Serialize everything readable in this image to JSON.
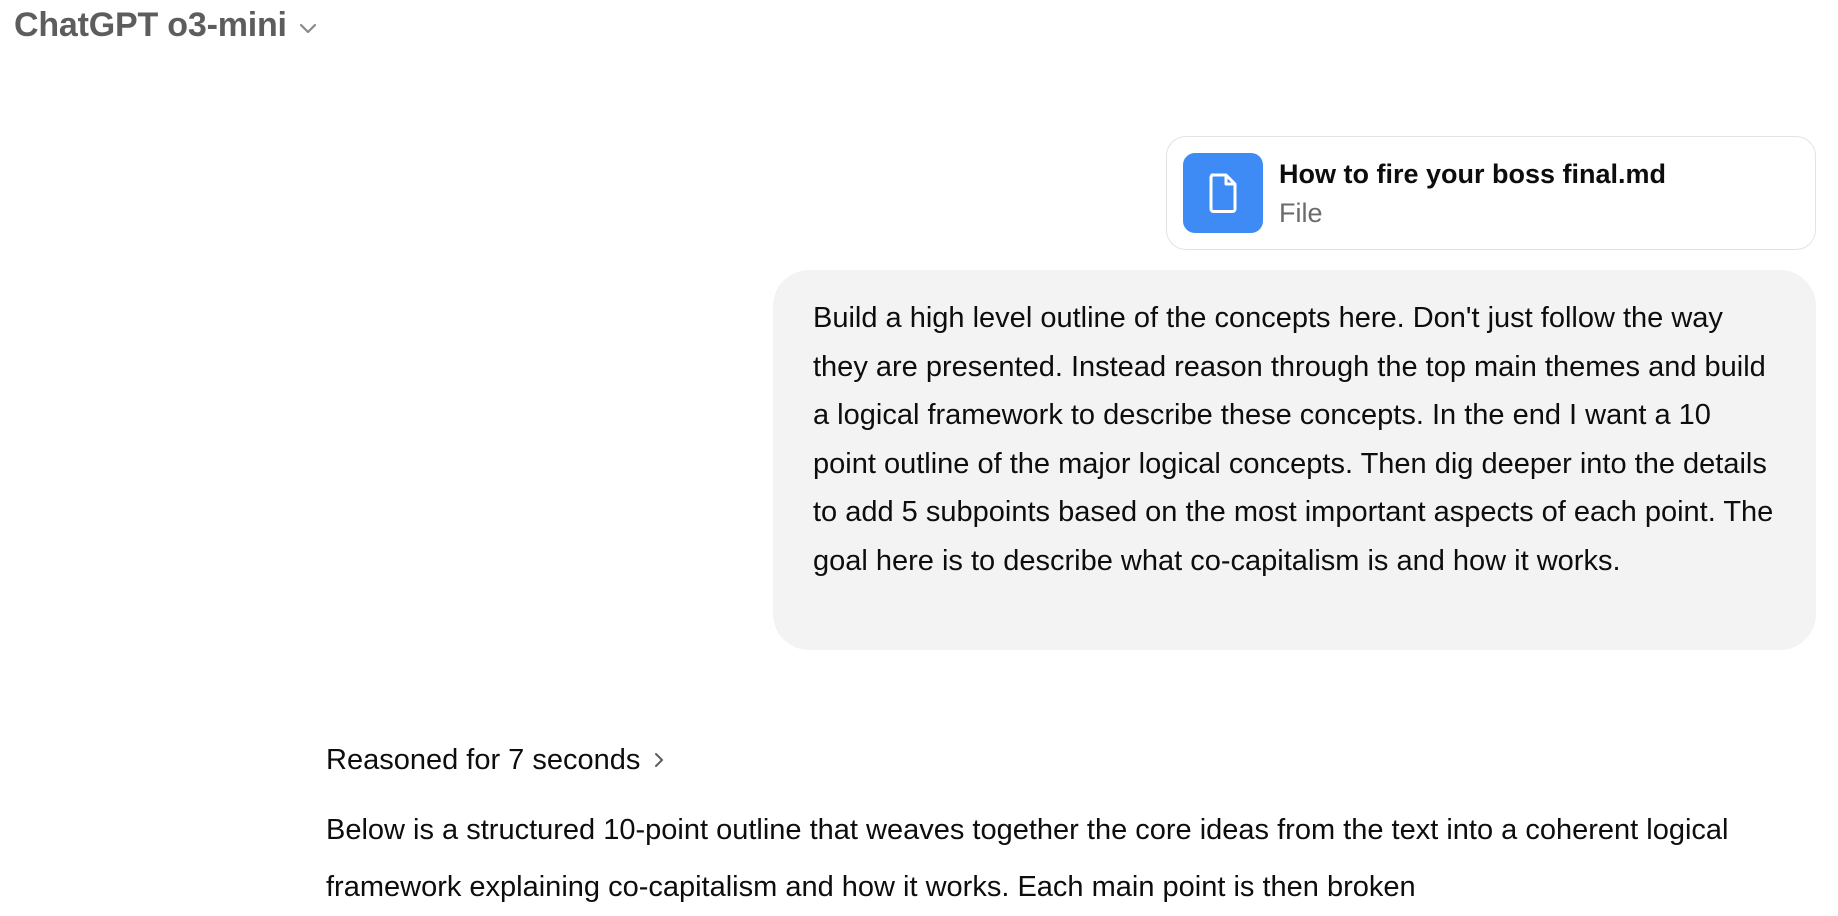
{
  "header": {
    "model_title": "ChatGPT o3-mini",
    "dropdown_icon": "chevron-down-icon"
  },
  "attachment": {
    "file_name": "How to fire your boss final.md",
    "file_type": "File",
    "icon": "document-icon",
    "icon_color": "#3e8bf6"
  },
  "user_message": {
    "text": "Build a high level outline of the concepts here. Don't just follow the way they are presented. Instead reason through the top main themes and build a logical framework to describe these concepts. In the end I want a 10 point outline of the major logical concepts. Then dig deeper into the details to add 5 subpoints based on the most important aspects of each point. The goal here is to describe what co-capitalism is and how it works."
  },
  "assistant": {
    "reasoning_label": "Reasoned for 7 seconds",
    "reasoning_icon": "chevron-right-icon",
    "response_text": "Below is a structured 10-point outline that weaves together the core ideas from the text into a coherent logical framework explaining co-capitalism and how it works. Each main point is then broken"
  }
}
